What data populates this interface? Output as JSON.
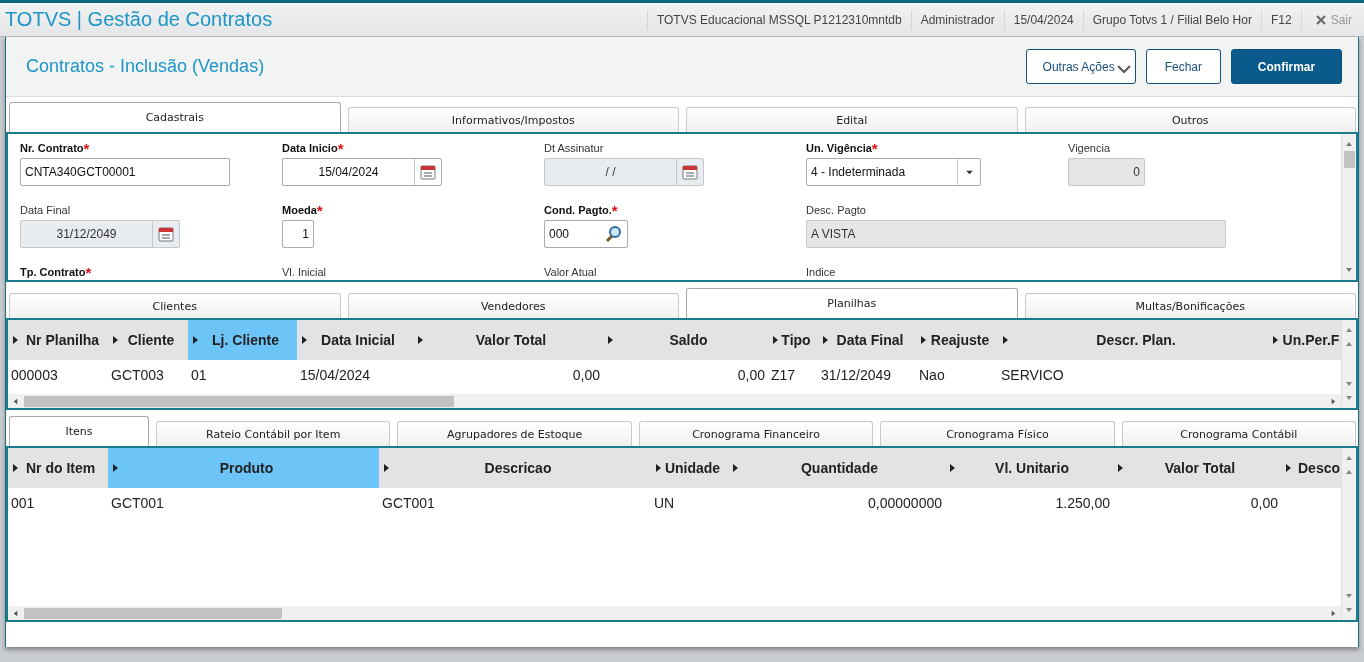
{
  "app": {
    "title": "TOTVS | Gestão de Contratos",
    "info": [
      "TOTVS Educacional MSSQL P1212310mntdb",
      "Administrador",
      "15/04/2024",
      "Grupo Totvs 1 / Filial Belo Hor",
      "F12"
    ],
    "exit": {
      "label": "Sair",
      "disabled": true
    }
  },
  "page": {
    "title": "Contratos - Inclusão (Vendas)",
    "buttons": [
      {
        "label": "Outras Ações",
        "kind": "menu"
      },
      {
        "label": "Fechar",
        "kind": "secondary"
      },
      {
        "label": "Confirmar",
        "kind": "primary"
      }
    ]
  },
  "form_tabs": [
    {
      "label": "Cadastrais",
      "selected": true
    },
    {
      "label": "Informativos/Impostos",
      "selected": false
    },
    {
      "label": "Edital",
      "selected": false
    },
    {
      "label": "Outros",
      "selected": false
    }
  ],
  "form": {
    "rows": [
      [
        {
          "label": "Nr. Contrato",
          "mark": "*",
          "kind": "text",
          "value": "CNTA340GCT00001",
          "disabled": false
        },
        {
          "label": "Data Inicio",
          "mark": "*",
          "kind": "date",
          "value": "15/04/2024",
          "disabled": false
        },
        {
          "label": "Dt Assinatur",
          "kind": "date",
          "value": "/  /",
          "disabled": true
        },
        {
          "label": "Un. Vigência",
          "mark": "*",
          "kind": "select",
          "value": "4 - Indeterminada",
          "disabled": false
        },
        {
          "label": "Vigencia",
          "kind": "number",
          "value": "0",
          "disabled": true
        }
      ],
      [
        {
          "label": "Data Final",
          "kind": "date",
          "value": "31/12/2049",
          "disabled": true
        },
        {
          "label": "Moeda",
          "mark": "*",
          "kind": "number",
          "value": "1",
          "disabled": false
        },
        {
          "label": "Cond. Pagto.",
          "mark": "*",
          "kind": "lookup",
          "value": "000",
          "disabled": false
        },
        {
          "label": "Desc. Pagto",
          "kind": "text",
          "value": "A VISTA",
          "disabled": true
        }
      ],
      [
        {
          "label": "Tp. Contrato",
          "mark": "*"
        },
        {
          "label": "Vl. Inicial"
        },
        {
          "label": "Valor Atual"
        },
        {
          "label": "Indice"
        }
      ]
    ]
  },
  "grid_tabs": [
    {
      "label": "Clientes",
      "selected": false
    },
    {
      "label": "Vendedores",
      "selected": false
    },
    {
      "label": "Planilhas",
      "selected": true
    },
    {
      "label": "Multas/Bonificações",
      "selected": false
    }
  ],
  "planilhas": {
    "columns": [
      {
        "label": "Nr Planilha",
        "kind": "text",
        "selected": false
      },
      {
        "label": "Cliente",
        "kind": "text",
        "selected": false
      },
      {
        "label": "Lj. Cliente",
        "kind": "text",
        "selected": true
      },
      {
        "label": "Data Inicial",
        "kind": "text",
        "selected": false
      },
      {
        "label": "Valor Total",
        "kind": "number",
        "selected": false
      },
      {
        "label": "Saldo",
        "kind": "number",
        "selected": false
      },
      {
        "label": "Tipo",
        "kind": "text",
        "selected": false
      },
      {
        "label": "Data Final",
        "kind": "text",
        "selected": false
      },
      {
        "label": "Reajuste",
        "kind": "text",
        "selected": false
      },
      {
        "label": "Descr. Plan.",
        "kind": "text",
        "selected": false
      },
      {
        "label": "Un.Per.F",
        "kind": "text",
        "selected": false
      }
    ],
    "rows": [
      [
        "000003",
        "GCT003",
        "01",
        "15/04/2024",
        "0,00",
        "0,00",
        "Z17",
        "31/12/2049",
        "Nao",
        "SERVICO"
      ]
    ]
  },
  "item_tabs": [
    {
      "label": "Itens",
      "selected": true
    },
    {
      "label": "Rateio Contábil por Item",
      "selected": false
    },
    {
      "label": "Agrupadores de Estoque",
      "selected": false
    },
    {
      "label": "Cronograma Financeiro",
      "selected": false
    },
    {
      "label": "Cronograma Físico",
      "selected": false
    },
    {
      "label": "Cronograma Contábil",
      "selected": false
    }
  ],
  "itens": {
    "columns": [
      {
        "label": "Nr do Item",
        "kind": "text",
        "selected": false
      },
      {
        "label": "Produto",
        "kind": "text",
        "selected": true
      },
      {
        "label": "Descricao",
        "kind": "text",
        "selected": false
      },
      {
        "label": "Unidade",
        "kind": "text",
        "selected": false
      },
      {
        "label": "Quantidade",
        "kind": "number",
        "selected": false
      },
      {
        "label": "Vl. Unitario",
        "kind": "number",
        "selected": false
      },
      {
        "label": "Valor Total",
        "kind": "number",
        "selected": false
      },
      {
        "label": "Desco",
        "kind": "number",
        "selected": false
      }
    ],
    "rows": [
      [
        "001",
        "GCT001",
        "GCT001",
        "UN",
        "0,00000000",
        "1.250,00",
        "0,00"
      ]
    ]
  }
}
